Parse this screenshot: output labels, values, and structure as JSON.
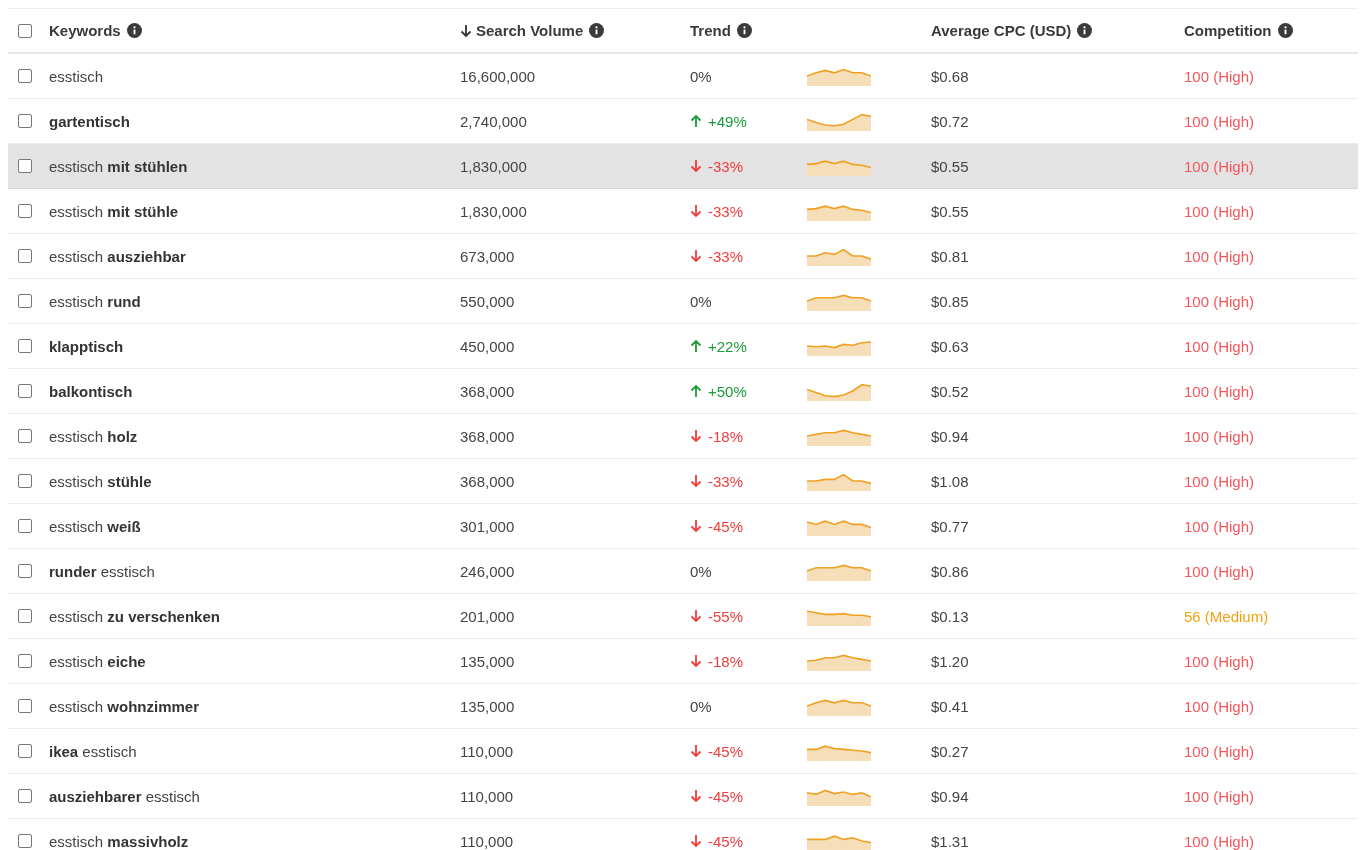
{
  "header": {
    "checked": false,
    "columns": [
      {
        "label": "Keywords",
        "sorted": false,
        "info": true
      },
      {
        "label": "Search Volume",
        "sorted": true,
        "info": true
      },
      {
        "label": "Trend",
        "sorted": false,
        "info": true
      },
      {
        "label": "Average CPC (USD)",
        "sorted": false,
        "info": true
      },
      {
        "label": "Competition",
        "sorted": false,
        "info": true
      }
    ]
  },
  "rows": [
    {
      "checked": false,
      "highlighted": false,
      "keyword": "esstisch",
      "volume": "16,600,000",
      "trend": "0%",
      "kind": "flat",
      "cpc": "$0.68",
      "competition": {
        "text": "100 (High)",
        "color": "#f5565c"
      }
    },
    {
      "checked": false,
      "highlighted": false,
      "keyword": "**gartentisch**",
      "volume": "2,740,000",
      "trend": "+49%",
      "kind": "up",
      "cpc": "$0.72",
      "competition": {
        "text": "100 (High)",
        "color": "#f5565c"
      }
    },
    {
      "checked": false,
      "highlighted": true,
      "keyword": "esstisch **mit stühlen**",
      "volume": "1,830,000",
      "trend": "-33%",
      "kind": "down",
      "cpc": "$0.55",
      "competition": {
        "text": "100 (High)",
        "color": "#f5565c"
      }
    },
    {
      "checked": false,
      "highlighted": false,
      "keyword": "esstisch **mit stühle**",
      "volume": "1,830,000",
      "trend": "-33%",
      "kind": "down",
      "cpc": "$0.55",
      "competition": {
        "text": "100 (High)",
        "color": "#f5565c"
      }
    },
    {
      "checked": false,
      "highlighted": false,
      "keyword": "esstisch **ausziehbar**",
      "volume": "673,000",
      "trend": "-33%",
      "kind": "down",
      "cpc": "$0.81",
      "competition": {
        "text": "100 (High)",
        "color": "#f5565c"
      }
    },
    {
      "checked": false,
      "highlighted": false,
      "keyword": "esstisch **rund**",
      "volume": "550,000",
      "trend": "0%",
      "kind": "flat",
      "cpc": "$0.85",
      "competition": {
        "text": "100 (High)",
        "color": "#f5565c"
      }
    },
    {
      "checked": false,
      "highlighted": false,
      "keyword": "**klapptisch**",
      "volume": "450,000",
      "trend": "+22%",
      "kind": "up",
      "cpc": "$0.63",
      "competition": {
        "text": "100 (High)",
        "color": "#f5565c"
      }
    },
    {
      "checked": false,
      "highlighted": false,
      "keyword": "**balkontisch**",
      "volume": "368,000",
      "trend": "+50%",
      "kind": "up",
      "cpc": "$0.52",
      "competition": {
        "text": "100 (High)",
        "color": "#f5565c"
      }
    },
    {
      "checked": false,
      "highlighted": false,
      "keyword": "esstisch **holz**",
      "volume": "368,000",
      "trend": "-18%",
      "kind": "down",
      "cpc": "$0.94",
      "competition": {
        "text": "100 (High)",
        "color": "#f5565c"
      }
    },
    {
      "checked": false,
      "highlighted": false,
      "keyword": "esstisch **stühle**",
      "volume": "368,000",
      "trend": "-33%",
      "kind": "down",
      "cpc": "$1.08",
      "competition": {
        "text": "100 (High)",
        "color": "#f5565c"
      }
    },
    {
      "checked": false,
      "highlighted": false,
      "keyword": "esstisch **weiß**",
      "volume": "301,000",
      "trend": "-45%",
      "kind": "down",
      "cpc": "$0.77",
      "competition": {
        "text": "100 (High)",
        "color": "#f5565c"
      }
    },
    {
      "checked": false,
      "highlighted": false,
      "keyword": "**runder** esstisch",
      "volume": "246,000",
      "trend": "0%",
      "kind": "flat",
      "cpc": "$0.86",
      "competition": {
        "text": "100 (High)",
        "color": "#f5565c"
      }
    },
    {
      "checked": false,
      "highlighted": false,
      "keyword": "esstisch **zu verschenken**",
      "volume": "201,000",
      "trend": "-55%",
      "kind": "down",
      "cpc": "$0.13",
      "competition": {
        "text": "56 (Medium)",
        "color": "#f2a20c"
      }
    },
    {
      "checked": false,
      "highlighted": false,
      "keyword": "esstisch **eiche**",
      "volume": "135,000",
      "trend": "-18%",
      "kind": "down",
      "cpc": "$1.20",
      "competition": {
        "text": "100 (High)",
        "color": "#f5565c"
      }
    },
    {
      "checked": false,
      "highlighted": false,
      "keyword": "esstisch **wohnzimmer**",
      "volume": "135,000",
      "trend": "0%",
      "kind": "flat",
      "cpc": "$0.41",
      "competition": {
        "text": "100 (High)",
        "color": "#f5565c"
      }
    },
    {
      "checked": false,
      "highlighted": false,
      "keyword": "**ikea** esstisch",
      "volume": "110,000",
      "trend": "-45%",
      "kind": "down",
      "cpc": "$0.27",
      "competition": {
        "text": "100 (High)",
        "color": "#f5565c"
      }
    },
    {
      "checked": false,
      "highlighted": false,
      "keyword": "**ausziehbarer** esstisch",
      "volume": "110,000",
      "trend": "-45%",
      "kind": "down",
      "cpc": "$0.94",
      "competition": {
        "text": "100 (High)",
        "color": "#f5565c"
      }
    },
    {
      "checked": false,
      "highlighted": false,
      "keyword": "esstisch **massivholz**",
      "volume": "110,000",
      "trend": "-45%",
      "kind": "down",
      "cpc": "$1.31",
      "competition": {
        "text": "100 (High)",
        "color": "#f5565c"
      }
    }
  ]
}
